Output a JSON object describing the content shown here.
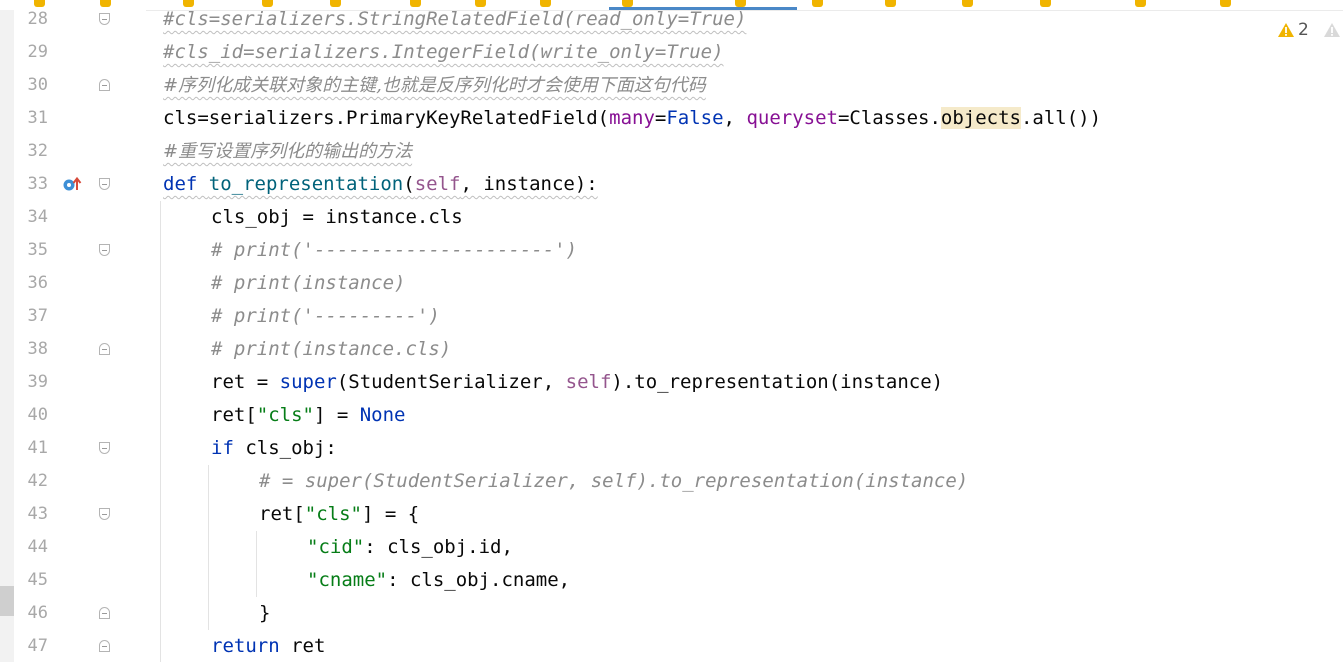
{
  "editor": {
    "warning_count": "2",
    "colors": {
      "keyword": "#0033b3",
      "comment": "#8c8c8c",
      "string": "#067d17",
      "self": "#94558d",
      "function": "#00627a",
      "param": "#871094",
      "highlight": "#f5eaca"
    },
    "lines": [
      {
        "num": "28",
        "text": "#cls=serializers.StringRelatedField(read_only=True)"
      },
      {
        "num": "29",
        "text": "#cls_id=serializers.IntegerField(write_only=True)"
      },
      {
        "num": "30",
        "text": "#序列化成关联对象的主键,也就是反序列化时才会使用下面这句代码"
      },
      {
        "num": "31",
        "p1": "cls=serializers.PrimaryKeyRelatedField(",
        "p2": "many",
        "p3": "=",
        "p4": "False",
        "p5": ", ",
        "p6": "queryset",
        "p7": "=Classes.",
        "p8": "objects",
        "p9": ".all())"
      },
      {
        "num": "32",
        "text": "#重写设置序列化的输出的方法"
      },
      {
        "num": "33",
        "p1": "def",
        "p2": " ",
        "p3": "to_representation",
        "p4": "(",
        "p5": "self",
        "p6": ", instance):"
      },
      {
        "num": "34",
        "text": "cls_obj = instance.cls"
      },
      {
        "num": "35",
        "text": "# print('---------------------')"
      },
      {
        "num": "36",
        "text": "# print(instance)"
      },
      {
        "num": "37",
        "text": "# print('---------')"
      },
      {
        "num": "38",
        "text": "# print(instance.cls)"
      },
      {
        "num": "39",
        "p1": "ret = ",
        "p2": "super",
        "p3": "(StudentSerializer, ",
        "p4": "self",
        "p5": ").to_representation(instance)"
      },
      {
        "num": "40",
        "p1": "ret[",
        "p2": "\"cls\"",
        "p3": "] = ",
        "p4": "None"
      },
      {
        "num": "41",
        "p1": "if",
        "p2": " cls_obj:"
      },
      {
        "num": "42",
        "text": "# = super(StudentSerializer, self).to_representation(instance)"
      },
      {
        "num": "43",
        "p1": "ret[",
        "p2": "\"cls\"",
        "p3": "] = {"
      },
      {
        "num": "44",
        "p1": "\"cid\"",
        "p2": ": cls_obj.id,"
      },
      {
        "num": "45",
        "p1": "\"cname\"",
        "p2": ": cls_obj.cname,"
      },
      {
        "num": "46",
        "text": "}"
      },
      {
        "num": "47",
        "p1": "return",
        "p2": " ret"
      }
    ]
  }
}
